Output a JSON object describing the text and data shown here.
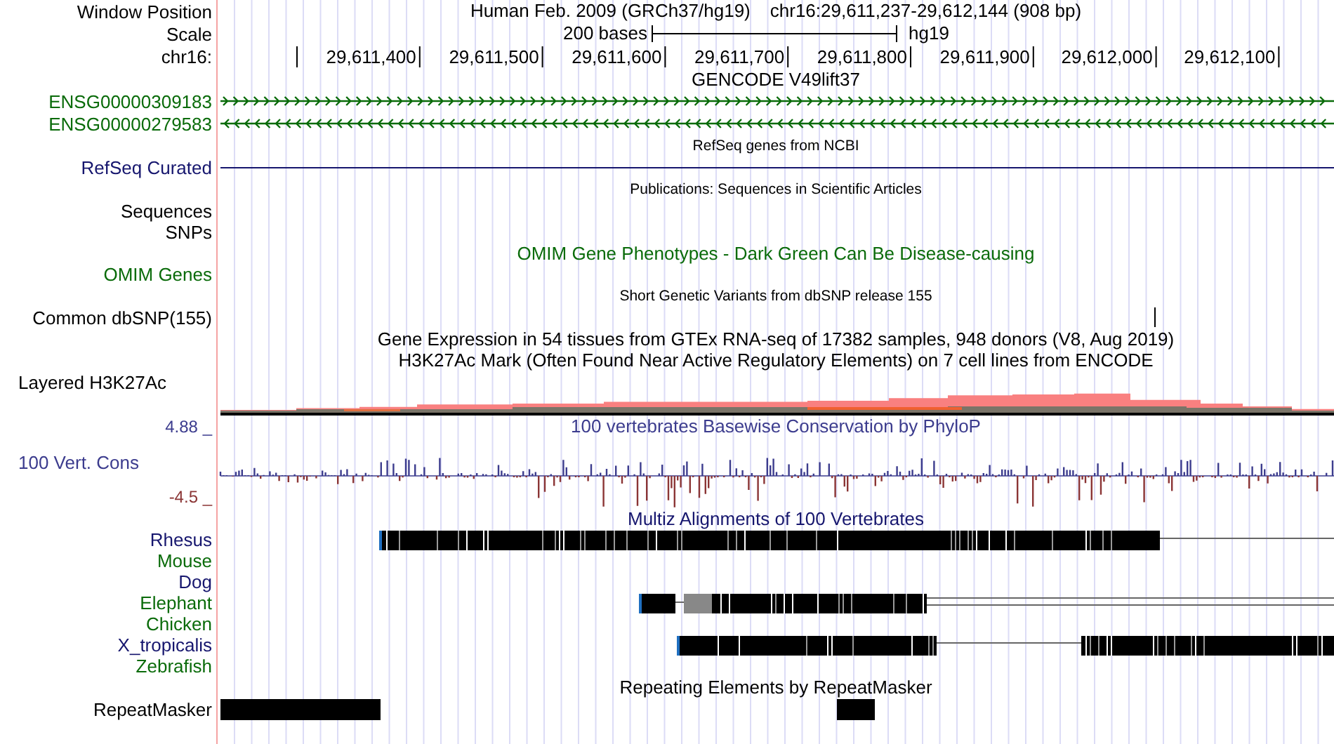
{
  "header": {
    "window_position_label": "Window Position",
    "assembly": "Human Feb. 2009 (GRCh37/hg19)",
    "position": "chr16:29,611,237-29,612,144 (908 bp)",
    "scale_label": "Scale",
    "scale_bar": "200 bases",
    "scale_db": "hg19",
    "chrom_label": "chr16:",
    "ruler_ticks": [
      "29,611,400",
      "29,611,500",
      "29,611,600",
      "29,611,700",
      "29,611,800",
      "29,611,900",
      "29,612,000",
      "29,612,100"
    ]
  },
  "tracks": [
    {
      "kind": "title",
      "text": "GENCODE V49lift37",
      "color": "#000000"
    },
    {
      "kind": "gene",
      "label": "ENSG00000309183",
      "color": "#0a6b0a",
      "reverse": false
    },
    {
      "kind": "gene",
      "label": "ENSG00000279583",
      "color": "#0a6b0a",
      "reverse": true
    },
    {
      "kind": "note",
      "text": "RefSeq genes from NCBI"
    },
    {
      "kind": "line",
      "label": "RefSeq Curated",
      "color": "#16166e"
    },
    {
      "kind": "note",
      "text": "Publications: Sequences in Scientific Articles"
    },
    {
      "kind": "label",
      "label": "Sequences",
      "color": "#000000"
    },
    {
      "kind": "label",
      "label": "SNPs",
      "color": "#000000"
    },
    {
      "kind": "title",
      "text": "OMIM Gene Phenotypes - Dark Green Can Be Disease-causing",
      "color": "#0a6b0a"
    },
    {
      "kind": "label",
      "label": "OMIM Genes",
      "color": "#0a6b0a"
    },
    {
      "kind": "note",
      "text": "Short Genetic Variants from dbSNP release 155"
    },
    {
      "kind": "snp",
      "label": "Common dbSNP(155)",
      "color": "#000000"
    },
    {
      "kind": "title",
      "text": "Gene Expression in 54 tissues from GTEx RNA-seq of 17382 samples, 948 donors (V8, Aug 2019)",
      "color": "#000000"
    },
    {
      "kind": "title",
      "text": "H3K27Ac Mark (Often Found Near Active Regulatory Elements) on 7 cell lines from ENCODE",
      "color": "#000000"
    },
    {
      "kind": "signal",
      "label": "Layered H3K27Ac",
      "color": "#000000"
    },
    {
      "kind": "wiggle",
      "label": "100 Vert. Cons",
      "color": "#3c3c8e",
      "upper": "4.88 _",
      "lower": "-4.5 _",
      "title": "100 vertebrates Basewise Conservation by PhyloP"
    },
    {
      "kind": "title",
      "text": "Multiz Alignments of 100 Vertebrates",
      "color": "#16166e"
    },
    {
      "kind": "alignment",
      "label": "Rhesus",
      "color": "#16166e"
    },
    {
      "kind": "alignment",
      "label": "Mouse",
      "color": "#0a6b0a"
    },
    {
      "kind": "alignment",
      "label": "Dog",
      "color": "#16166e"
    },
    {
      "kind": "alignment",
      "label": "Elephant",
      "color": "#0a6b0a"
    },
    {
      "kind": "alignment",
      "label": "Chicken",
      "color": "#0a6b0a"
    },
    {
      "kind": "alignment",
      "label": "X_tropicalis",
      "color": "#16166e"
    },
    {
      "kind": "alignment",
      "label": "Zebrafish",
      "color": "#0a6b0a"
    },
    {
      "kind": "title",
      "text": "Repeating Elements by RepeatMasker",
      "color": "#000000"
    },
    {
      "kind": "repeat",
      "label": "RepeatMasker",
      "color": "#000000"
    }
  ]
}
